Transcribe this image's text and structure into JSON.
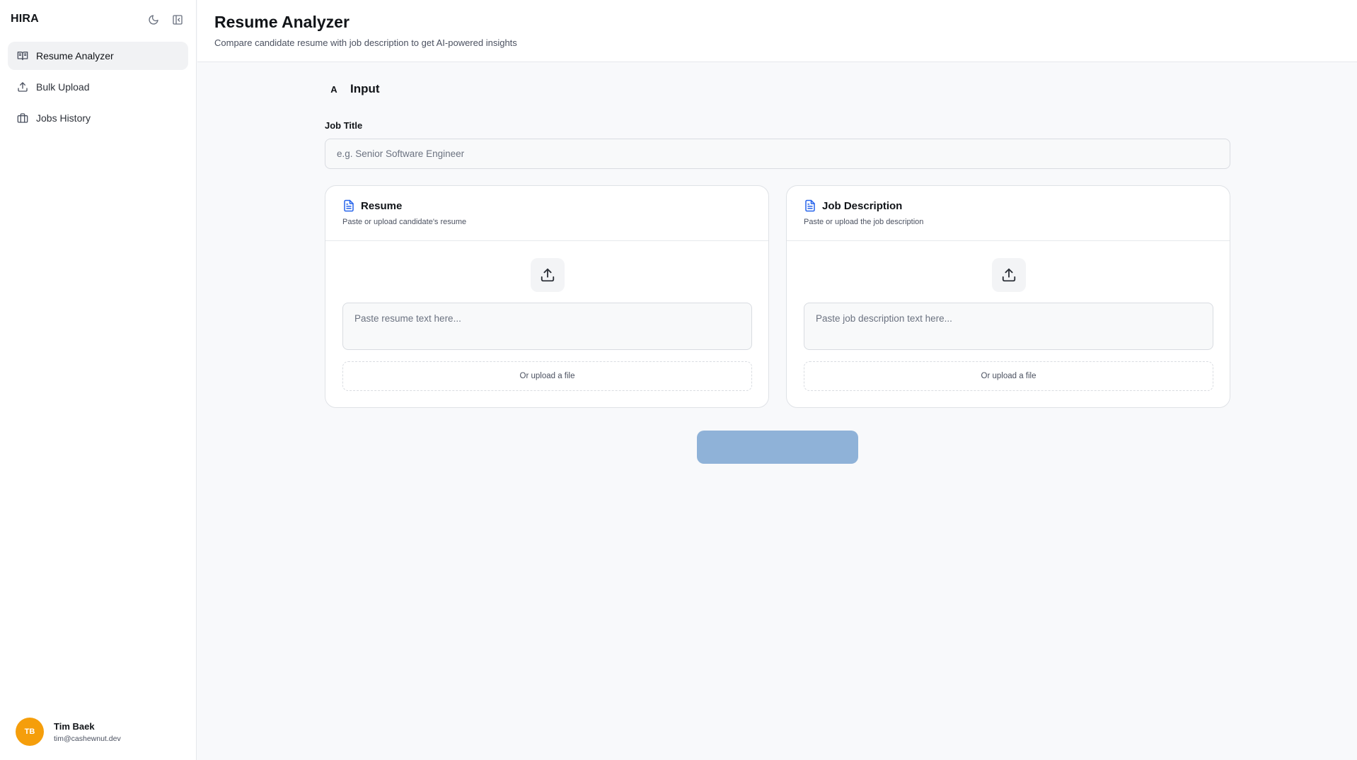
{
  "sidebar": {
    "brand": "HIRA",
    "theme_toggle_icon": "moon-icon",
    "collapse_icon": "sidebar-collapse-icon",
    "items": [
      {
        "label": "Resume Analyzer",
        "icon": "book-open-icon",
        "active": true
      },
      {
        "label": "Bulk Upload",
        "icon": "upload-icon",
        "active": false
      },
      {
        "label": "Jobs History",
        "icon": "briefcase-icon",
        "active": false
      }
    ],
    "user": {
      "initials": "TB",
      "name": "Tim Baek",
      "email": "tim@cashewnut.dev",
      "avatar_color": "#f59e0b"
    }
  },
  "header": {
    "title": "Resume Analyzer",
    "subtitle": "Compare candidate resume with job description to get AI-powered insights"
  },
  "main": {
    "section": {
      "icon_glyph": "A",
      "title": "Input"
    },
    "job_title": {
      "label": "Job Title",
      "value": "",
      "placeholder": "e.g. Senior Software Engineer"
    },
    "cards": [
      {
        "title": "Resume",
        "description": "Paste or upload candidate's resume",
        "text_placeholder": "Paste resume text here...",
        "upload_label": "Or upload a file"
      },
      {
        "title": "Job Description",
        "description": "Paste or upload the job description",
        "text_placeholder": "Paste job description text here...",
        "upload_label": "Or upload a file"
      }
    ],
    "analyze_button": {
      "label": "",
      "state": "disabled",
      "color": "#8fb2d8"
    }
  },
  "colors": {
    "accent": "#2563eb",
    "avatar": "#f59e0b",
    "disabled_button": "#8fb2d8"
  }
}
